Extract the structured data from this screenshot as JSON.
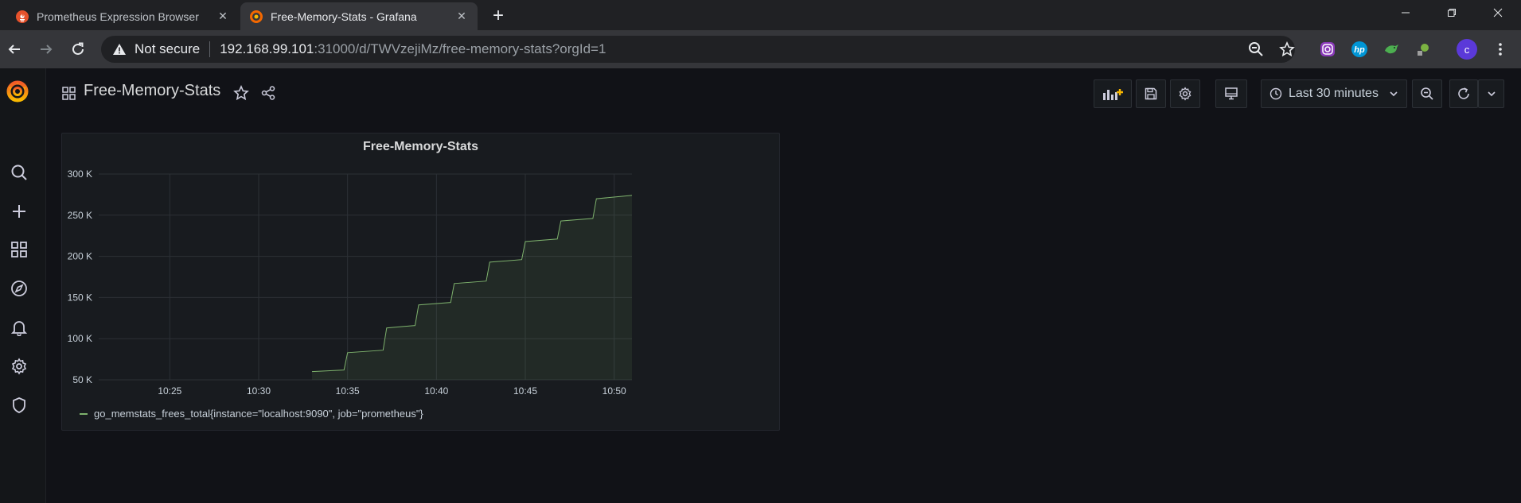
{
  "browser": {
    "tabs": [
      {
        "title": "Prometheus Expression Browser",
        "active": false
      },
      {
        "title": "Free-Memory-Stats - Grafana",
        "active": true
      }
    ],
    "address": {
      "security_label": "Not secure",
      "host": "192.168.99.101",
      "path": ":31000/d/TWVzejiMz/free-memory-stats?orgId=1"
    },
    "profile_initial": "c"
  },
  "dashboard": {
    "title": "Free-Memory-Stats",
    "time_range_label": "Last 30 minutes"
  },
  "panel": {
    "title": "Free-Memory-Stats",
    "legend_label": "go_memstats_frees_total{instance=\"localhost:9090\", job=\"prometheus\"}"
  },
  "colors": {
    "series": "#7eb26d",
    "background": "#111217",
    "panel_bg": "#181b1f",
    "grid": "#2c3036"
  },
  "chart_data": {
    "type": "area",
    "title": "Free-Memory-Stats",
    "xlabel": "",
    "ylabel": "",
    "x_ticks": [
      "10:25",
      "10:30",
      "10:35",
      "10:40",
      "10:45",
      "10:50"
    ],
    "y_ticks": [
      "50 K",
      "100 K",
      "150 K",
      "200 K",
      "250 K",
      "300 K"
    ],
    "xlim": [
      "10:21",
      "10:51"
    ],
    "ylim": [
      50000,
      300000
    ],
    "grid": true,
    "legend": "bottom-left",
    "series": [
      {
        "name": "go_memstats_frees_total{instance=\"localhost:9090\", job=\"prometheus\"}",
        "x": [
          "10:33",
          "10:34.8",
          "10:35",
          "10:37",
          "10:37.2",
          "10:38.8",
          "10:39",
          "10:40.8",
          "10:41",
          "10:42.8",
          "10:43",
          "10:44.8",
          "10:45",
          "10:46.8",
          "10:47",
          "10:48.8",
          "10:49",
          "10:51"
        ],
        "y": [
          60000,
          62000,
          83000,
          86000,
          113000,
          116000,
          141000,
          144000,
          167000,
          170000,
          193000,
          196000,
          218000,
          221000,
          243000,
          246000,
          270000,
          274000
        ]
      }
    ]
  }
}
